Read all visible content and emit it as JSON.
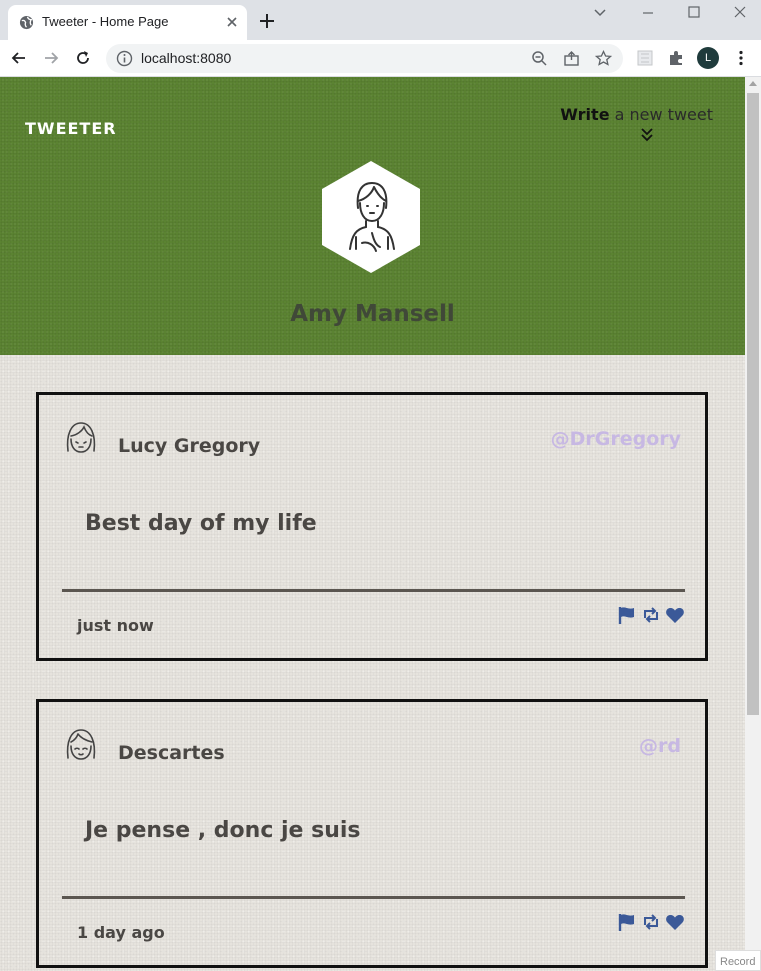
{
  "browser": {
    "tab_title": "Tweeter - Home Page",
    "url": "localhost:8080",
    "profile_initial": "L",
    "record_label": "Record"
  },
  "header": {
    "brand": "TWEETER",
    "compose_strong": "Write",
    "compose_rest": " a new tweet",
    "profile_name": "Amy Mansell"
  },
  "tweets": [
    {
      "name": "Lucy Gregory",
      "handle": "@DrGregory",
      "body": "Best day of my life",
      "time": "just now"
    },
    {
      "name": "Descartes",
      "handle": "@rd",
      "body": "Je pense , donc je suis",
      "time": "1 day ago"
    }
  ],
  "colors": {
    "header_green": "#5b8332",
    "handle_lilac": "#c7b8e3",
    "action_blue": "#3b5998",
    "text_dark": "#4a4744"
  },
  "icons": {
    "tweet_actions": [
      "flag-icon",
      "retweet-icon",
      "heart-icon"
    ]
  }
}
